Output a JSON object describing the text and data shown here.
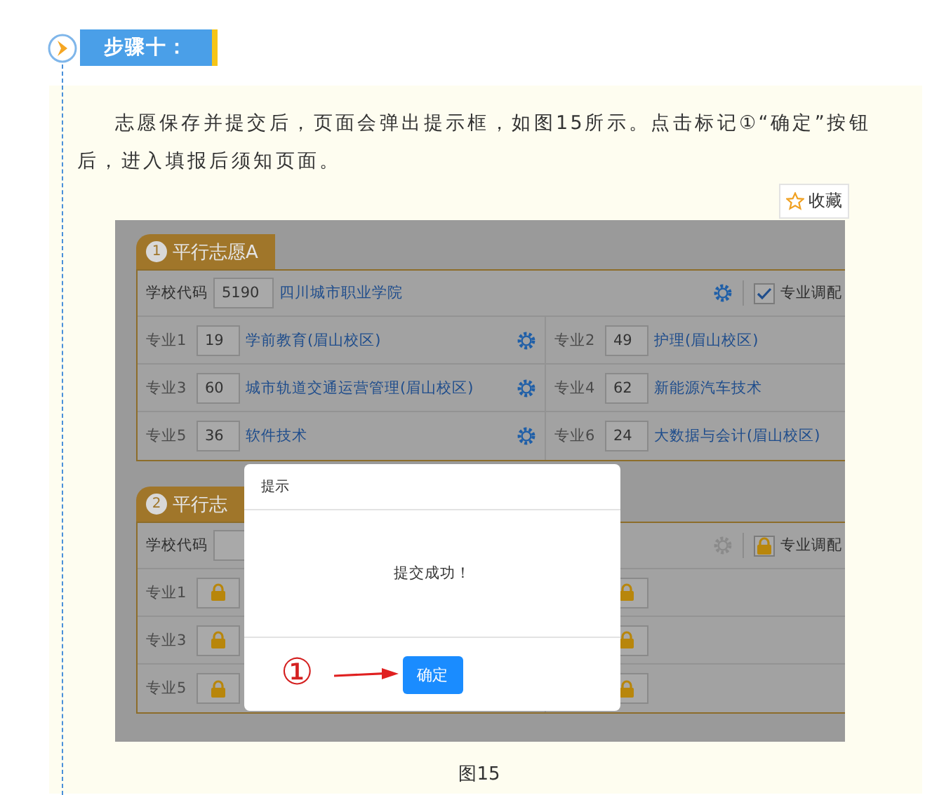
{
  "step": {
    "label": "步骤十："
  },
  "article": {
    "paragraph": "志愿保存并提交后，页面会弹出提示框，如图15所示。点击标记①“确定”按钮后，进入填报后须知页面。",
    "favorite_button": "收藏",
    "figure": {
      "panels": [
        {
          "index": "1",
          "title": "平行志愿A",
          "locked": false,
          "school_label": "学校代码",
          "school_code": "5190",
          "school_name": "四川城市职业学院",
          "adjust_label": "专业调配",
          "adjust_checked": true,
          "majors": [
            {
              "label": "专业1",
              "code": "19",
              "name": "学前教育(眉山校区)"
            },
            {
              "label": "专业2",
              "code": "49",
              "name": "护理(眉山校区)"
            },
            {
              "label": "专业3",
              "code": "60",
              "name": "城市轨道交通运营管理(眉山校区)"
            },
            {
              "label": "专业4",
              "code": "62",
              "name": "新能源汽车技术"
            },
            {
              "label": "专业5",
              "code": "36",
              "name": "软件技术"
            },
            {
              "label": "专业6",
              "code": "24",
              "name": "大数据与会计(眉山校区)"
            }
          ]
        },
        {
          "index": "2",
          "title": "平行志",
          "locked": true,
          "school_label": "学校代码",
          "adjust_label": "专业调配",
          "majors": [
            {
              "label": "专业1"
            },
            {
              "label": "专业3"
            },
            {
              "label": "专业5"
            }
          ]
        }
      ],
      "dialog": {
        "title": "提示",
        "message": "提交成功！",
        "confirm_button": "确定",
        "annotation": "①"
      }
    },
    "caption": "图15"
  }
}
